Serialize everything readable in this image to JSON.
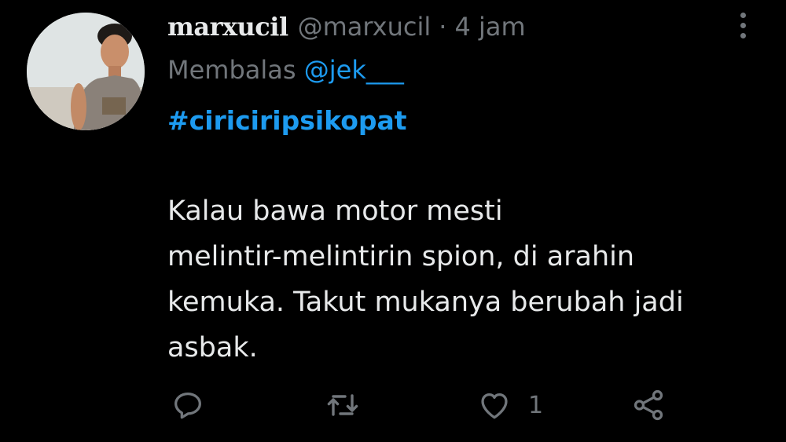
{
  "tweet": {
    "display_name": "marxucil",
    "handle": "@marxucil",
    "separator": "·",
    "time": "4 jam",
    "replying_prefix": "Membalas",
    "replying_to": "@jek___",
    "hashtag": "#ciriciripsikopat",
    "body": "Kalau bawa motor mesti\nmelintir-melintirin spion, di arahin\nkemuka. Takut mukanya berubah jadi\nasbak.",
    "like_count": "1"
  },
  "icons": {
    "more": "more-vertical-icon",
    "reply": "reply-icon",
    "retweet": "retweet-icon",
    "like": "heart-icon",
    "share": "share-icon"
  },
  "colors": {
    "background": "#000000",
    "primary_text": "#e7e9ea",
    "secondary_text": "#71767b",
    "accent": "#1d9bf0"
  }
}
